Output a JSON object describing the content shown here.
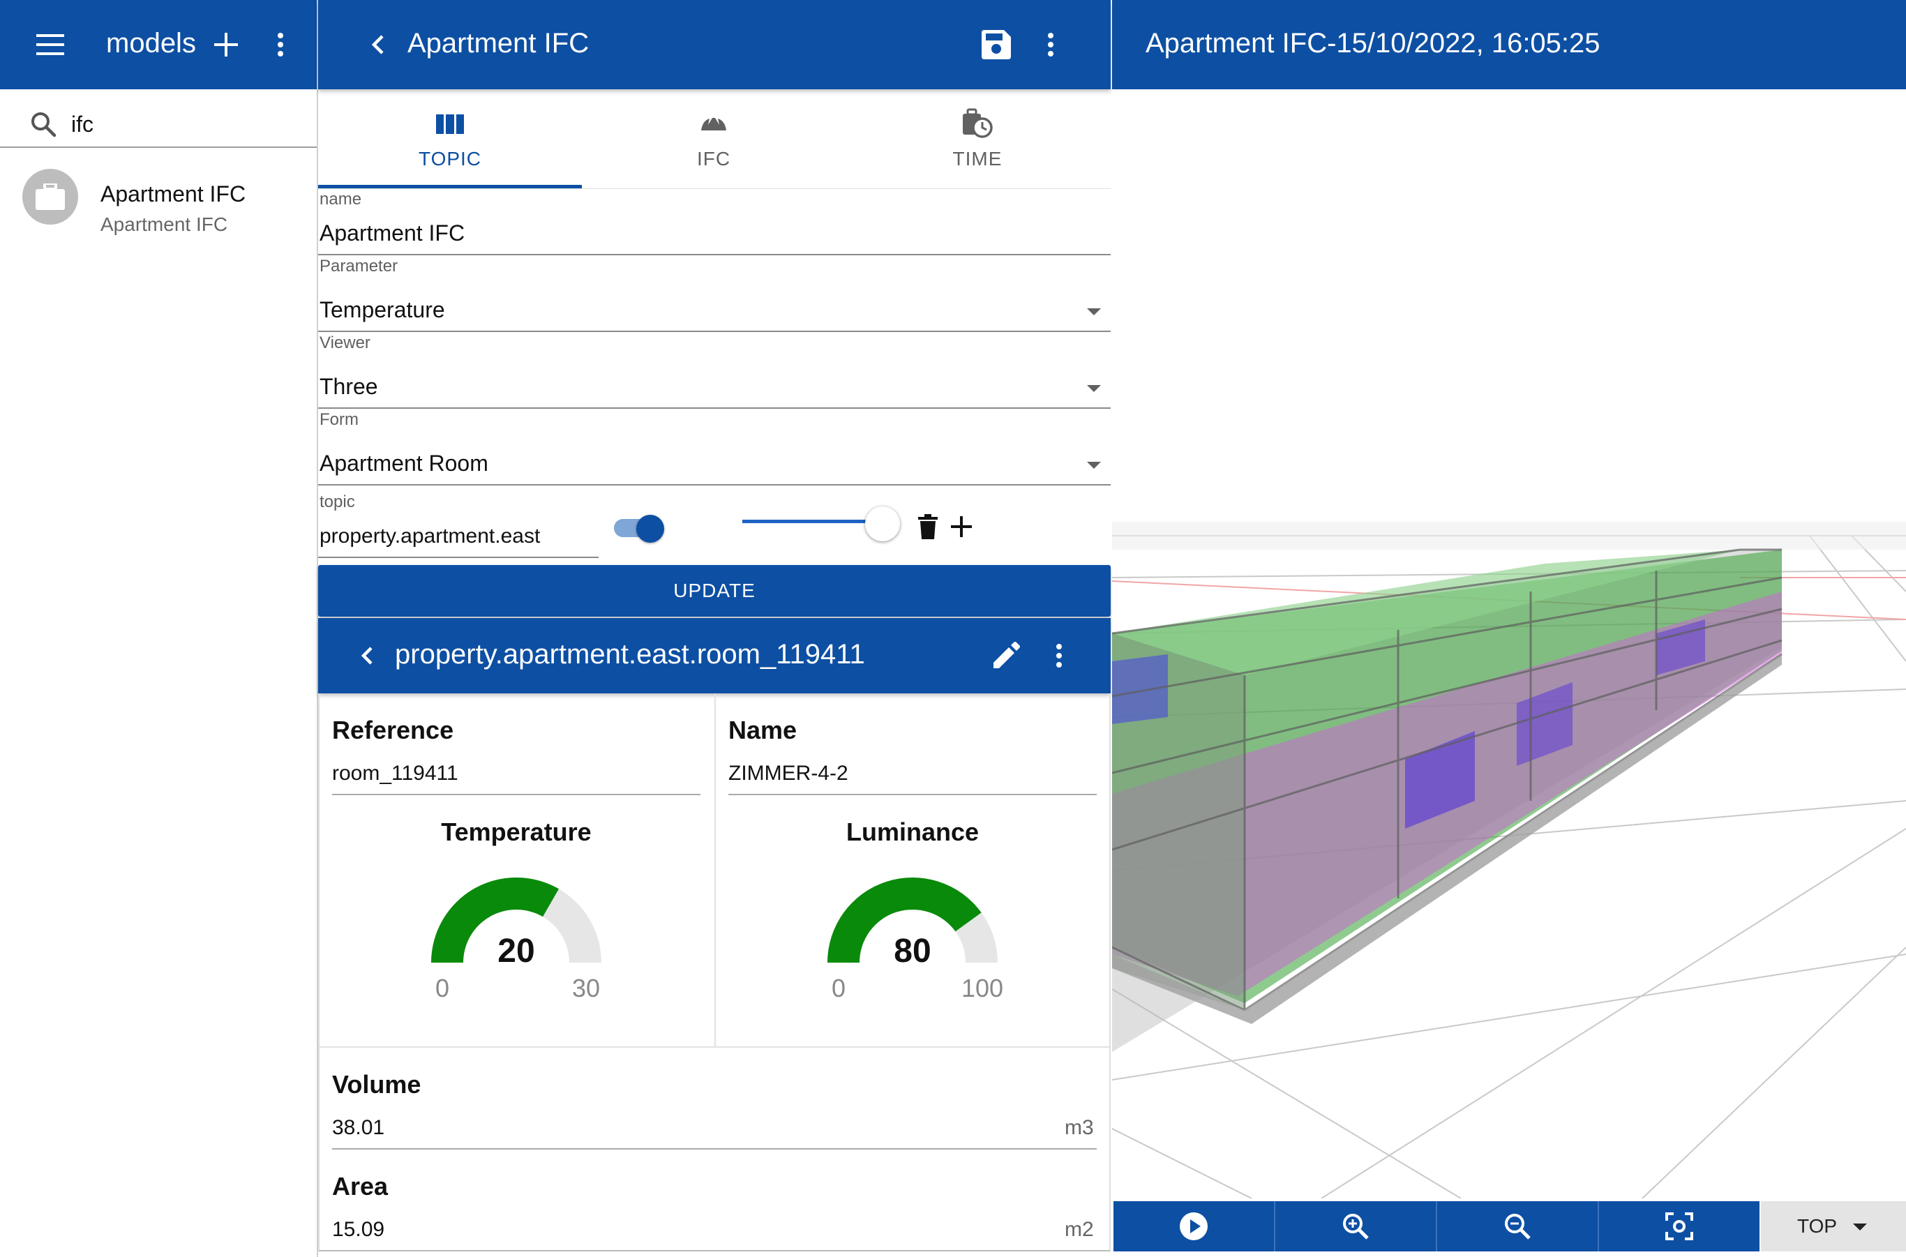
{
  "left_panel": {
    "title": "models",
    "search_value": "ifc",
    "list": [
      {
        "title": "Apartment IFC",
        "subtitle": "Apartment IFC"
      }
    ]
  },
  "middle_panel": {
    "title": "Apartment IFC",
    "tabs": [
      {
        "label": "TOPIC",
        "icon": "columns-icon",
        "active": true
      },
      {
        "label": "IFC",
        "icon": "ifc-icon",
        "active": false
      },
      {
        "label": "TIME",
        "icon": "time-icon",
        "active": false
      }
    ],
    "form": {
      "name_label": "name",
      "name_value": "Apartment IFC",
      "parameter_label": "Parameter",
      "parameter_value": "Temperature",
      "viewer_label": "Viewer",
      "viewer_value": "Three",
      "form_label": "Form",
      "form_value": "Apartment Room",
      "topic_label": "topic",
      "topic_value": "property.apartment.east",
      "toggle_on": true,
      "slider_level": 0.98,
      "update_label": "UPDATE"
    },
    "room": {
      "title": "property.apartment.east.room_119411",
      "reference_label": "Reference",
      "reference_value": "room_119411",
      "name_label": "Name",
      "name_value": "ZIMMER-4-2",
      "temperature": {
        "title": "Temperature",
        "value": "20",
        "min": "0",
        "max": "30"
      },
      "luminance": {
        "title": "Luminance",
        "value": "80",
        "min": "0",
        "max": "100"
      },
      "volume_label": "Volume",
      "volume_value": "38.01",
      "volume_unit": "m3",
      "area_label": "Area",
      "area_value": "15.09",
      "area_unit": "m2"
    }
  },
  "viewer_panel": {
    "title": "Apartment IFC-15/10/2022, 16:05:25",
    "view_select": "TOP"
  },
  "colors": {
    "primary": "#0d4fa3",
    "gauge": "#0a8a0a"
  }
}
